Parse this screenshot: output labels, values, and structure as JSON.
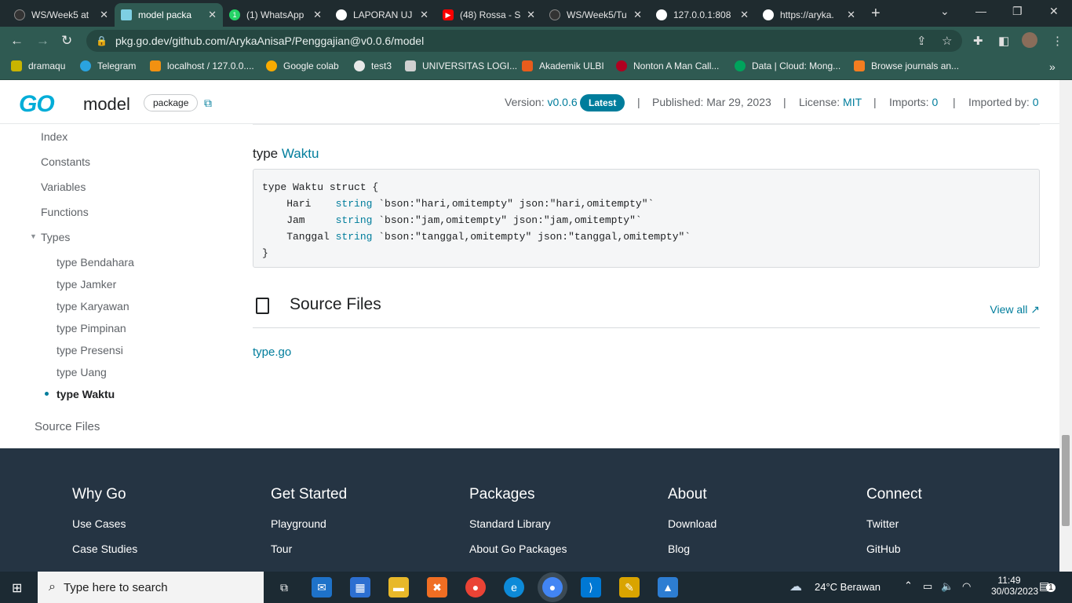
{
  "browser": {
    "tabs": [
      {
        "label": "WS/Week5 at",
        "icon": "github-icon",
        "active": false
      },
      {
        "label": "model packa",
        "icon": "go-dev-icon",
        "active": true
      },
      {
        "label": "(1) WhatsApp",
        "icon": "whatsapp-icon",
        "active": false
      },
      {
        "label": "LAPORAN UJ",
        "icon": "globe-icon",
        "active": false
      },
      {
        "label": "(48) Rossa - S",
        "icon": "youtube-icon",
        "active": false
      },
      {
        "label": "WS/Week5/Tu",
        "icon": "github-icon",
        "active": false
      },
      {
        "label": "127.0.0.1:808",
        "icon": "globe-icon",
        "active": false
      },
      {
        "label": "https://aryka.",
        "icon": "globe-icon",
        "active": false
      }
    ],
    "url": "pkg.go.dev/github.com/ArykaAnisaP/Penggajian@v0.0.6/model",
    "bookmarks": [
      {
        "label": "dramaqu",
        "color": "#c8b400"
      },
      {
        "label": "Telegram",
        "color": "#2aa3df"
      },
      {
        "label": "localhost / 127.0.0....",
        "color": "#f29111"
      },
      {
        "label": "Google colab",
        "color": "#f9ab00"
      },
      {
        "label": "test3",
        "color": "#e8e8e8"
      },
      {
        "label": "UNIVERSITAS LOGI...",
        "color": "#d0d0d0"
      },
      {
        "label": "Akademik ULBI",
        "color": "#e85c1c"
      },
      {
        "label": "Nonton A Man Call...",
        "color": "#b00020"
      },
      {
        "label": "Data | Cloud: Mong...",
        "color": "#00a35c"
      },
      {
        "label": "Browse journals an...",
        "color": "#f47d20"
      }
    ]
  },
  "header": {
    "logo": "GO",
    "package_name": "model",
    "badge": "package",
    "version_label": "Version:",
    "version": "v0.0.6",
    "latest": "Latest",
    "published": "Published: Mar 29, 2023",
    "license_label": "License:",
    "license": "MIT",
    "imports_label": "Imports:",
    "imports": "0",
    "imported_label": "Imported by:",
    "imported": "0"
  },
  "sidebar": {
    "items": [
      "Index",
      "Constants",
      "Variables",
      "Functions",
      "Types"
    ],
    "types": [
      "type Bendahara",
      "type Jamker",
      "type Karyawan",
      "type Pimpinan",
      "type Presensi",
      "type Uang",
      "type Waktu"
    ],
    "source_files": "Source Files"
  },
  "main": {
    "type_prefix": "type",
    "type_name": "Waktu",
    "code": {
      "l1": "type Waktu struct {",
      "f1": "    Hari    ",
      "t1": "string",
      "r1": " `bson:\"hari,omitempty\" json:\"hari,omitempty\"`",
      "f2": "    Jam     ",
      "t2": "string",
      "r2": " `bson:\"jam,omitempty\" json:\"jam,omitempty\"`",
      "f3": "    Tanggal ",
      "t3": "string",
      "r3": " `bson:\"tanggal,omitempty\" json:\"tanggal,omitempty\"`",
      "l5": "}"
    },
    "source_title": "Source Files",
    "view_all": "View all",
    "file": "type.go"
  },
  "footer": {
    "columns": [
      {
        "title": "Why Go",
        "links": [
          "Use Cases",
          "Case Studies"
        ]
      },
      {
        "title": "Get Started",
        "links": [
          "Playground",
          "Tour"
        ]
      },
      {
        "title": "Packages",
        "links": [
          "Standard Library",
          "About Go Packages"
        ]
      },
      {
        "title": "About",
        "links": [
          "Download",
          "Blog"
        ]
      },
      {
        "title": "Connect",
        "links": [
          "Twitter",
          "GitHub"
        ]
      }
    ]
  },
  "taskbar": {
    "search_placeholder": "Type here to search",
    "weather": "24°C  Berawan",
    "time": "11:49",
    "date": "30/03/2023",
    "notif": "1"
  }
}
